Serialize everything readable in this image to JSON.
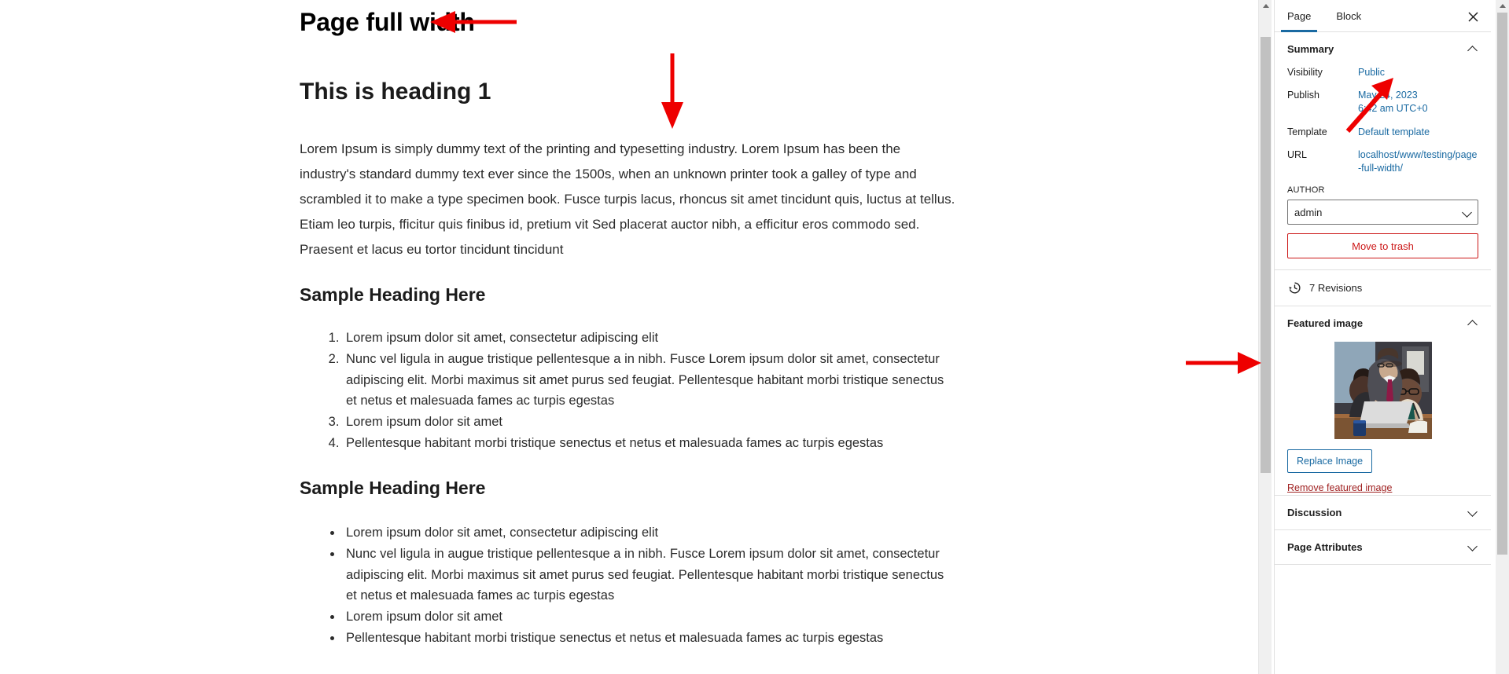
{
  "editor": {
    "post_title": "Page full width",
    "heading1": "This is heading 1",
    "paragraph": "Lorem Ipsum is simply dummy text of the printing and typesetting industry. Lorem Ipsum has been the industry's standard dummy text ever since the 1500s, when an unknown printer took a galley of type and scrambled it to make a type specimen book. Fusce turpis lacus, rhoncus sit amet tincidunt quis, luctus at tellus. Etiam leo turpis, fficitur quis finibus id, pretium vit Sed placerat auctor nibh, a efficitur eros commodo sed. Praesent et lacus eu tortor tincidunt tincidunt",
    "heading2_first": "Sample Heading Here",
    "ordered_list": [
      "Lorem ipsum dolor sit amet, consectetur adipiscing elit",
      "Nunc vel ligula in augue tristique pellentesque a in nibh. Fusce Lorem ipsum dolor sit amet, consectetur adipiscing elit. Morbi maximus sit amet purus sed feugiat. Pellentesque habitant morbi tristique senectus et netus et malesuada fames ac turpis egestas",
      "Lorem ipsum dolor sit amet",
      "Pellentesque habitant morbi tristique senectus et netus et malesuada fames ac turpis egestas"
    ],
    "heading2_second": "Sample Heading Here",
    "bullet_list": [
      "Lorem ipsum dolor sit amet, consectetur adipiscing elit",
      "Nunc vel ligula in augue tristique pellentesque a in nibh. Fusce Lorem ipsum dolor sit amet, consectetur adipiscing elit. Morbi maximus sit amet purus sed feugiat. Pellentesque habitant morbi tristique senectus et netus et malesuada fames ac turpis egestas",
      "Lorem ipsum dolor sit amet",
      "Pellentesque habitant morbi tristique senectus et netus et malesuada fames ac turpis egestas"
    ]
  },
  "sidebar": {
    "tabs": [
      {
        "label": "Page",
        "active": true
      },
      {
        "label": "Block",
        "active": false
      }
    ],
    "close_icon": "close-icon",
    "summary": {
      "title": "Summary",
      "rows": [
        {
          "label": "Visibility",
          "value": "Public"
        },
        {
          "label": "Publish",
          "value": "May 24, 2023\n6:42 am UTC+0"
        },
        {
          "label": "Template",
          "value": "Default template"
        },
        {
          "label": "URL",
          "value": "localhost/www/testing/page-full-width/"
        }
      ],
      "author_label": "AUTHOR",
      "author_value": "admin",
      "author_options": [
        "admin"
      ],
      "trash_label": "Move to trash"
    },
    "revisions": {
      "icon": "backup-clock-icon",
      "label": "7 Revisions"
    },
    "featured_image": {
      "title": "Featured image",
      "replace_label": "Replace Image",
      "remove_label": "Remove featured image",
      "alt": "business team meeting around laptop"
    },
    "collapsed_panels": [
      {
        "title": "Discussion"
      },
      {
        "title": "Page Attributes"
      }
    ]
  },
  "annotations": [
    {
      "name": "arrow-pointing-to-title",
      "direction": "left"
    },
    {
      "name": "arrow-pointing-to-paragraph",
      "direction": "down"
    },
    {
      "name": "arrow-pointing-to-visibility-public",
      "direction": "up-right"
    },
    {
      "name": "arrow-pointing-to-featured-image",
      "direction": "right"
    }
  ],
  "colors": {
    "accent_blue": "#1a6aa2",
    "annotation_red": "#ee0000",
    "trash_red": "#cc1818",
    "remove_link_red": "#a02222",
    "border_gray": "#e0e0e0"
  }
}
